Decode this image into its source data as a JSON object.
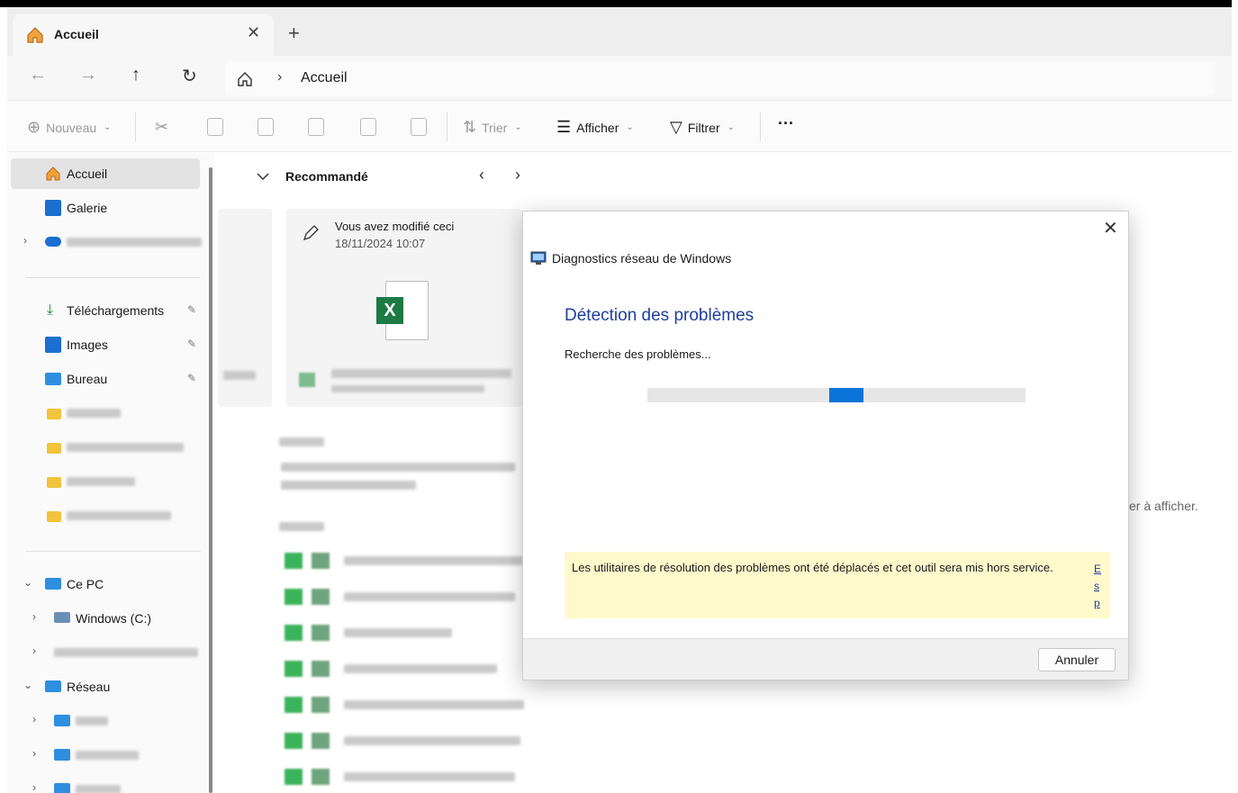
{
  "window": {
    "tab_label": "Accueil",
    "tab_close": "✕",
    "new_tab": "+"
  },
  "nav": {
    "back": "←",
    "forward": "→",
    "up": "↑",
    "refresh": "↻",
    "breadcrumb_separator": "›",
    "breadcrumb": "Accueil"
  },
  "toolbar": {
    "new_label": "Nouveau",
    "sort_label": "Trier",
    "view_label": "Afficher",
    "filter_label": "Filtrer",
    "more_label": "···"
  },
  "sidebar": {
    "home": "Accueil",
    "gallery": "Galerie",
    "downloads": "Téléchargements",
    "images": "Images",
    "desktop": "Bureau",
    "this_pc": "Ce PC",
    "windows_drive": "Windows (C:)",
    "network": "Réseau"
  },
  "main": {
    "recommended_header": "Recommandé",
    "card_title": "Vous avez modifié ceci",
    "card_date": "18/11/2024 10:07",
    "empty_hint": "er à afficher."
  },
  "dialog": {
    "app_title": "Diagnostics réseau de Windows",
    "heading": "Détection des problèmes",
    "status": "Recherche des problèmes...",
    "progress_chunk": {
      "start": 0.48,
      "end": 0.57
    },
    "notice": "Les utilitaires de résolution des problèmes ont été déplacés et cet outil sera mis hors service.",
    "notice_link": "E s p",
    "cancel_label": "Annuler",
    "close": "✕"
  },
  "colors": {
    "accent": "#0a74d8",
    "heading": "#1f3f9e",
    "notice_bg": "#fff9cc",
    "folder": "#f2c33b"
  }
}
